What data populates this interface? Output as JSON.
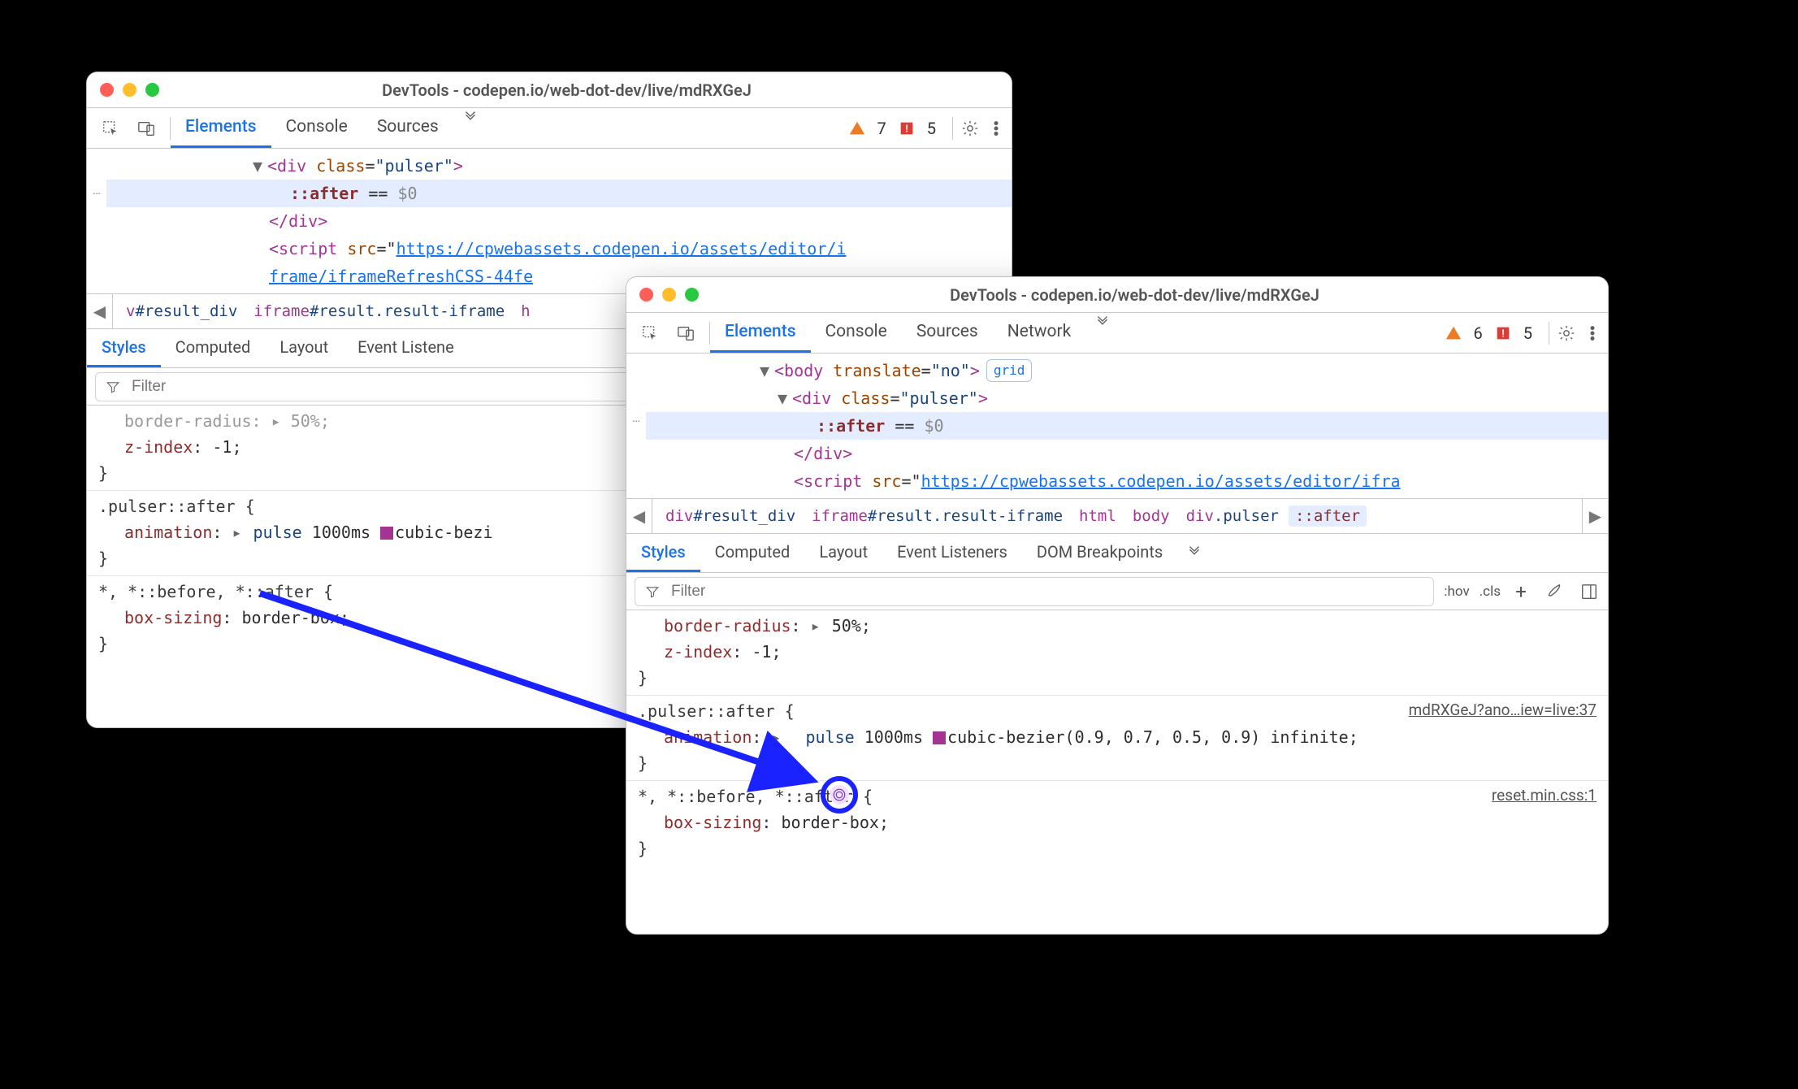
{
  "window_title": "DevTools - codepen.io/web-dot-dev/live/mdRXGeJ",
  "nav_tabs": {
    "elements": "Elements",
    "console": "Console",
    "sources": "Sources",
    "network": "Network"
  },
  "issues": {
    "warnings_1": 7,
    "errors_1": 5,
    "warnings_2": 6,
    "errors_2": 5
  },
  "dom": {
    "body": "<body translate=\"no\">",
    "div": "<div class=\"pulser\">",
    "after": "::after",
    "eq": " == ",
    "dollar": "$0",
    "div_close": "</div>",
    "script_prefix": "<script src=\"",
    "script_url": "https://cpwebassets.codepen.io/assets/editor/iframe/iframeRefreshCSS-44fe",
    "script_url2_prefix": "<script src=\"",
    "script_url2": "https://cpwebassets.codepen.io/assets/editor/ifra",
    "grid_pill": "grid",
    "ellipsis": "…"
  },
  "crumbs": {
    "result": "v#result_div",
    "result_full": "div#result_div",
    "iframe": "iframe#result.result-iframe",
    "html": "html",
    "body": "body",
    "pulser": "div.pulser",
    "after": "::after",
    "h": "h"
  },
  "sub_tabs": {
    "styles": "Styles",
    "computed": "Computed",
    "layout": "Layout",
    "listeners": "Event Listeners",
    "listeners_short": "Event Listene",
    "dom_bp": "DOM Breakpoints"
  },
  "filter": {
    "placeholder": "Filter",
    "hov": ":hov",
    "cls": ".cls"
  },
  "rules": {
    "trunc1": {
      "prop": "z-index",
      "val": "-1"
    },
    "border_radius_trunc": "border-radius: ▶ 50%;",
    "pulser_after": {
      "selector": ".pulser::after",
      "anim_prop": "animation",
      "anim_name": "pulse",
      "anim_dur": "1000ms",
      "anim_timing": "cubic-bezier(0.9, 0.7, 0.5, 0.9)",
      "anim_iter": "infinite",
      "brace_open": "{",
      "brace_close": "}",
      "anim_timing_trunc": "cubic-bezi"
    },
    "border_radius": {
      "prop": "border-radius",
      "val": "50%"
    },
    "universal": {
      "selector": "*, *::before, *::after",
      "prop": "box-sizing",
      "val": "border-box"
    },
    "src1": "mdRXGeJ?ano…iew=live:37",
    "src2": "reset.min.css:1"
  }
}
